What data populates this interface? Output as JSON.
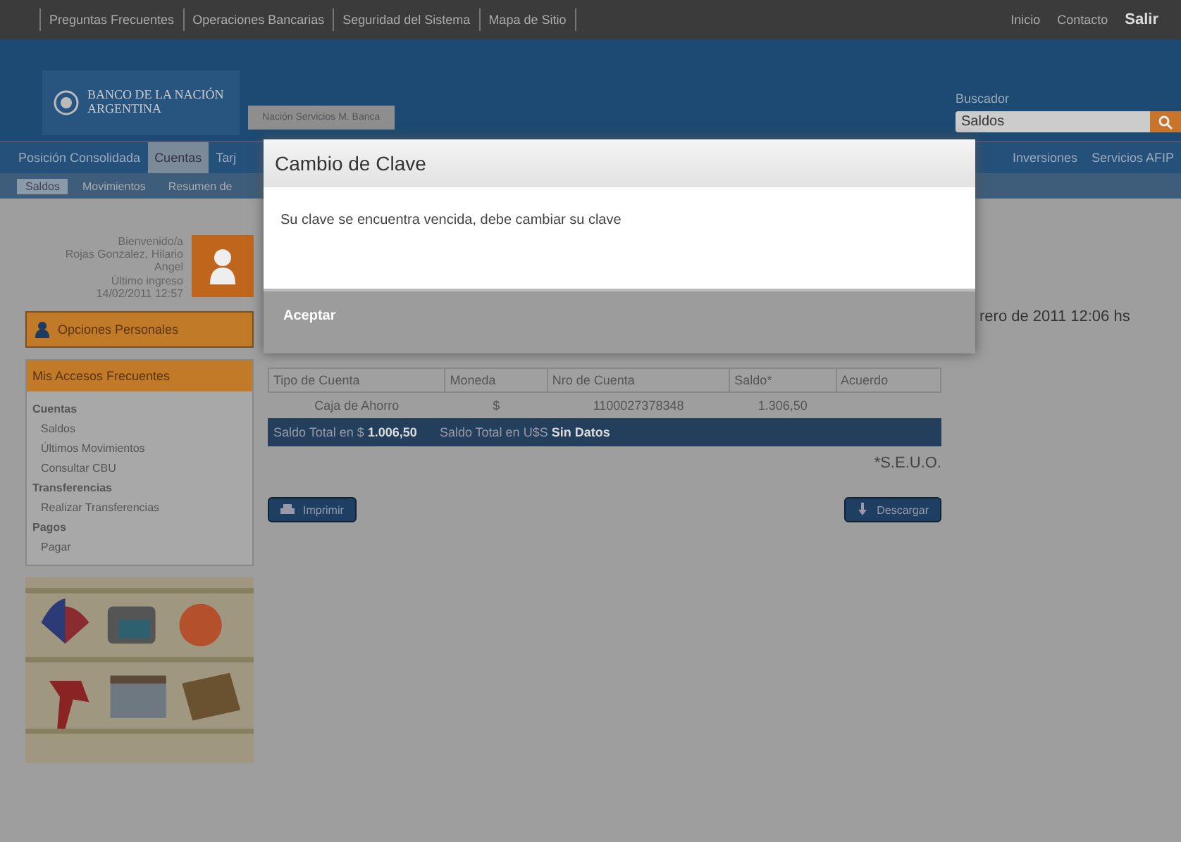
{
  "top_bar": {
    "links": [
      "Preguntas Frecuentes",
      "Operaciones Bancarias",
      "Seguridad del Sistema",
      "Mapa de Sitio"
    ],
    "right_links": [
      "Inicio",
      "Contacto",
      "Salir"
    ]
  },
  "header": {
    "logo": "BANCO DE LA NACIÓN ARGENTINA",
    "banner": "Nación Servicios M. Banca",
    "search": {
      "label": "Buscador",
      "value": "Saldos"
    }
  },
  "nav": {
    "tabs": [
      {
        "label": "Posición Consolidada",
        "selected": false
      },
      {
        "label": "Cuentas",
        "selected": true
      },
      {
        "label": "Tarj",
        "selected": false
      }
    ],
    "right_tabs": [
      "Inversiones",
      "Servicios AFIP"
    ]
  },
  "subnav": [
    {
      "label": "Saldos",
      "selected": true
    },
    {
      "label": "Movimientos",
      "selected": false
    },
    {
      "label": "Resumen de",
      "selected": false
    }
  ],
  "user": {
    "lines": [
      "Bienvenido/a",
      "Rojas Gonzalez, Hilario",
      "Angel",
      "Último ingreso",
      "14/02/2011 12:57"
    ]
  },
  "sidebar": {
    "personal_button": "Opciones Personales",
    "shortcuts_title": "Mis Accesos Frecuentes",
    "items": [
      {
        "label": "Cuentas",
        "kind": "group"
      },
      {
        "label": "Saldos",
        "kind": "link"
      },
      {
        "label": "Últimos Movimientos",
        "kind": "link"
      },
      {
        "label": "Consultar CBU",
        "kind": "link"
      },
      {
        "label": "Transferencias",
        "kind": "group"
      },
      {
        "label": "Realizar Transferencias",
        "kind": "link"
      },
      {
        "label": "Pagos",
        "kind": "group"
      },
      {
        "label": "Pagar",
        "kind": "link"
      }
    ]
  },
  "content": {
    "date": "rero de 2011  12:06 hs",
    "table": {
      "columns": [
        "Tipo de Cuenta",
        "Moneda",
        "Nro de Cuenta",
        "Saldo*",
        "Acuerdo"
      ],
      "rows": [
        [
          "Caja de Ahorro",
          "$",
          "1100027378348",
          "1.306,50",
          ""
        ]
      ]
    },
    "totals": [
      "Saldo Total en $ **1.006,50**",
      "Saldo Total en U$S **Sin Datos**"
    ],
    "note": "*S.E.U.O.",
    "buttons": [
      "Imprimir",
      "Descargar"
    ]
  },
  "dialog": {
    "title": "Cambio de Clave",
    "message": "Su clave se encuentra vencida, debe cambiar su clave",
    "button": "Aceptar"
  }
}
